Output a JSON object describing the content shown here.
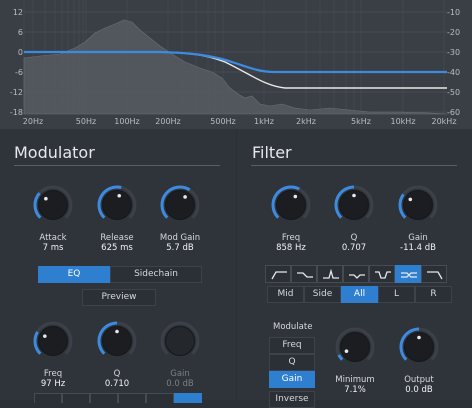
{
  "graph": {
    "y_left_labels": [
      "12",
      "6",
      "0",
      "-6",
      "-12",
      "-18"
    ],
    "y_right_labels": [
      "-10",
      "-20",
      "-30",
      "-40",
      "-50",
      "-60"
    ],
    "x_labels": [
      "20Hz",
      "50Hz",
      "100Hz",
      "200Hz",
      "500Hz",
      "1kHz",
      "2kHz",
      "5kHz",
      "10kHz",
      "20kHz"
    ],
    "colors": {
      "eq_curve": "#3d8be0",
      "response_curve": "#e8e8e8",
      "spectrum": "#5a5e65"
    }
  },
  "modulator": {
    "title": "Modulator",
    "knobs": [
      {
        "label": "Attack",
        "value": "7 ms",
        "level": 0.32
      },
      {
        "label": "Release",
        "value": "625 ms",
        "level": 0.55
      },
      {
        "label": "Mod Gain",
        "value": "5.7 dB",
        "level": 0.62
      }
    ],
    "mode_tabs": [
      {
        "label": "EQ",
        "active": true
      },
      {
        "label": "Sidechain",
        "active": false
      }
    ],
    "preview_label": "Preview",
    "bottom_knobs": [
      {
        "label": "Freq",
        "value": "97 Hz",
        "level": 0.28
      },
      {
        "label": "Q",
        "value": "0.710",
        "level": 0.5
      },
      {
        "label": "Gain",
        "value": "0.0 dB",
        "level": 0.5,
        "disabled": true
      }
    ]
  },
  "filter": {
    "title": "Filter",
    "knobs": [
      {
        "label": "Freq",
        "value": "858 Hz",
        "level": 0.6
      },
      {
        "label": "Q",
        "value": "0.707",
        "level": 0.5
      },
      {
        "label": "Gain",
        "value": "-11.4 dB",
        "level": 0.3
      }
    ],
    "shapes": [
      "low-cut",
      "low-shelf",
      "bell",
      "notch",
      "band-pass",
      "high-shelf-cross",
      "high-cut"
    ],
    "active_shape_index": 5,
    "channels": [
      {
        "label": "Mid",
        "active": false
      },
      {
        "label": "Side",
        "active": false
      },
      {
        "label": "All",
        "active": true
      },
      {
        "label": "L",
        "active": false
      },
      {
        "label": "R",
        "active": false
      }
    ],
    "modulate_label": "Modulate",
    "modulate_options": [
      {
        "label": "Freq",
        "active": false
      },
      {
        "label": "Q",
        "active": false
      },
      {
        "label": "Gain",
        "active": true
      }
    ],
    "inverse_label": "Inverse",
    "bottom_knobs": [
      {
        "label": "Minimum",
        "value": "7.1%",
        "level": 0.07
      },
      {
        "label": "Output",
        "value": "0.0 dB",
        "level": 0.5
      }
    ]
  }
}
